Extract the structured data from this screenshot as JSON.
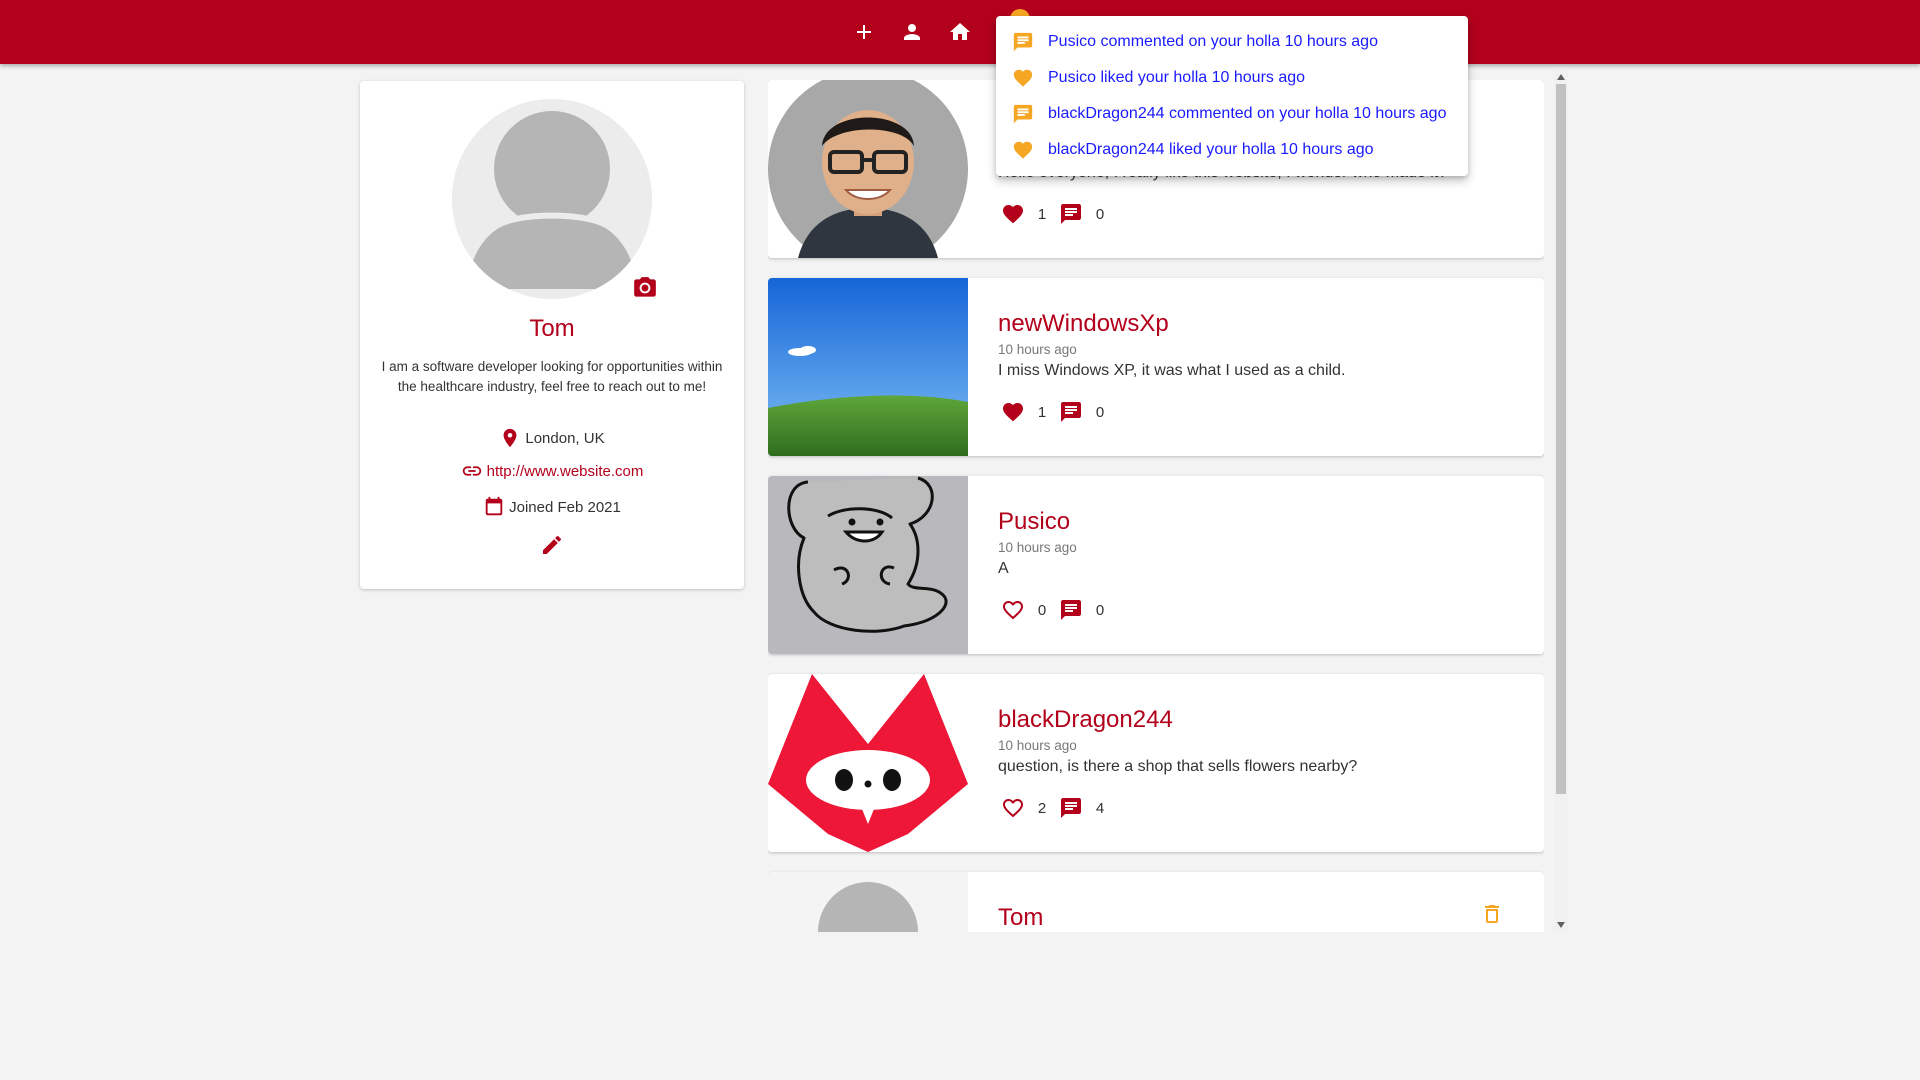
{
  "nav": {
    "add_icon": "plus-icon",
    "profile_icon": "person-icon",
    "home_icon": "home-icon",
    "notifications_icon": "bell-icon",
    "badge_color": "#f5a623",
    "bar_color": "#b3001b"
  },
  "notifications": [
    {
      "type": "comment",
      "icon": "comment-icon",
      "text": "Pusico commented on your holla 10 hours ago"
    },
    {
      "type": "like",
      "icon": "heart-icon",
      "text": "Pusico liked your holla 10 hours ago"
    },
    {
      "type": "comment",
      "icon": "comment-icon",
      "text": "blackDragon244 commented on your holla 10 hours ago"
    },
    {
      "type": "like",
      "icon": "heart-icon",
      "text": "blackDragon244 liked your holla 10 hours ago"
    }
  ],
  "profile": {
    "name": "Tom",
    "bio": "I am a software developer looking for opportunities within the healthcare industry, feel free to reach out to me!",
    "location": "London, UK",
    "website": "http://www.website.com",
    "joined": "Joined Feb 2021"
  },
  "posts": [
    {
      "author": "",
      "time": "",
      "body": "Hello everyone, I really like this website, I wonder who made it?",
      "liked": true,
      "likes": "1",
      "comments": "0",
      "image": "man-photo"
    },
    {
      "author": "newWindowsXp",
      "time": "10 hours ago",
      "body": "I miss Windows XP, it was what I used as a child.",
      "liked": true,
      "likes": "1",
      "comments": "0",
      "image": "bliss-landscape"
    },
    {
      "author": "Pusico",
      "time": "10 hours ago",
      "body": "A",
      "liked": false,
      "likes": "0",
      "comments": "0",
      "image": "elephant-drawing"
    },
    {
      "author": "blackDragon244",
      "time": "10 hours ago",
      "body": "question, is there a shop that sells flowers nearby?",
      "liked": false,
      "likes": "2",
      "comments": "4",
      "image": "red-fox-logo"
    },
    {
      "author": "Tom",
      "time": "",
      "body": "",
      "liked": false,
      "likes": "",
      "comments": "",
      "image": "default-avatar",
      "deletable": true
    }
  ]
}
